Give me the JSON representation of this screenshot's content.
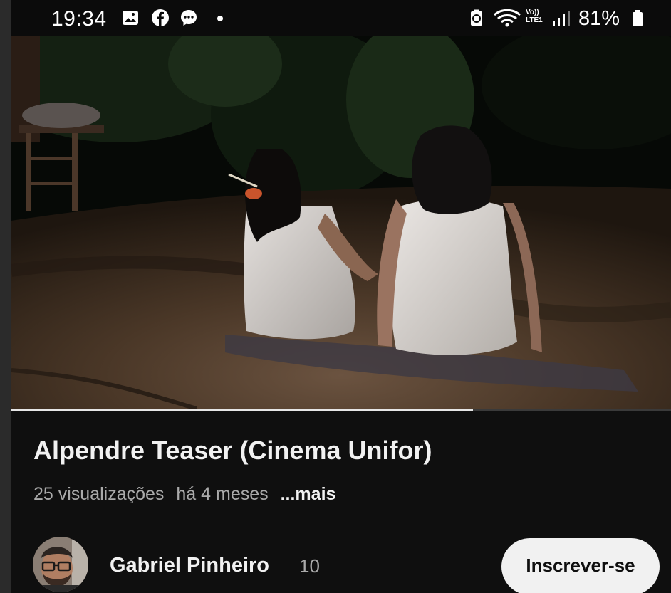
{
  "status_bar": {
    "time": "19:34",
    "network_label_top": "Vo))",
    "network_label_bottom": "LTE1",
    "battery_percent": "81%",
    "notification_icons": [
      "gallery-icon",
      "facebook-icon",
      "messenger-icon",
      "dot-icon"
    ],
    "system_icons": [
      "recycle-icon",
      "wifi-icon",
      "signal-icon",
      "battery-icon"
    ]
  },
  "video": {
    "progress": 0.7
  },
  "info": {
    "title": "Alpendre Teaser (Cinema Unifor)",
    "views": "25 visualizações",
    "age": "há 4 meses",
    "more": "...mais"
  },
  "channel": {
    "name": "Gabriel Pinheiro",
    "subscribers": "10",
    "subscribe_label": "Inscrever-se"
  },
  "colors": {
    "background": "#0f0f0f",
    "text_primary": "#f1f1f1",
    "text_secondary": "#aaaaaa",
    "button_bg": "#f1f1f1"
  }
}
